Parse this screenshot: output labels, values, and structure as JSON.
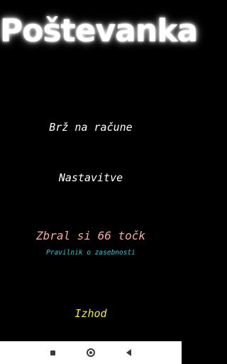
{
  "app": {
    "title": "Poštevanka"
  },
  "menu": {
    "fast_calc_label": "Brž na račune",
    "settings_label": "Nastavitve",
    "score_text": "Zbral si 66 točk",
    "privacy_label": "Pravilnik o zasebnosti",
    "exit_label": "Izhod"
  },
  "colors": {
    "background": "#000000",
    "menu_text": "#ffffff",
    "score_text": "#f4a9a0",
    "privacy_text": "#2ec9d6",
    "exit_text": "#f2e93a",
    "navbar": "#ffffff"
  },
  "navbar": {
    "icons": [
      "recents-square-icon",
      "home-circle-icon",
      "back-triangle-icon"
    ]
  }
}
